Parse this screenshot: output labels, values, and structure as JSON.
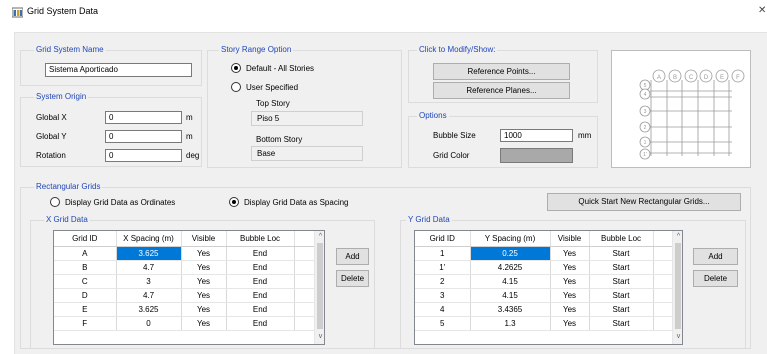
{
  "window": {
    "title": "Grid System Data",
    "close_glyph": "✕"
  },
  "grid_system_name": {
    "label": "Grid System Name",
    "value": "Sistema Aporticado"
  },
  "system_origin": {
    "label": "System Origin",
    "global_x": {
      "label": "Global  X",
      "value": "0",
      "unit": "m"
    },
    "global_y": {
      "label": "Global  Y",
      "value": "0",
      "unit": "m"
    },
    "rotation": {
      "label": "Rotation",
      "value": "0",
      "unit": "deg"
    }
  },
  "story_range": {
    "label": "Story Range Option",
    "default_label": "Default - All Stories",
    "user_label": "User Specified",
    "top_story_label": "Top Story",
    "top_story_value": "Piso 5",
    "bottom_story_label": "Bottom Story",
    "bottom_story_value": "Base",
    "selected": "default"
  },
  "modify_show": {
    "label": "Click to Modify/Show:",
    "reference_points": "Reference Points...",
    "reference_planes": "Reference Planes..."
  },
  "options": {
    "label": "Options",
    "bubble_size_label": "Bubble Size",
    "bubble_size_value": "1000",
    "bubble_size_unit": "mm",
    "grid_color_label": "Grid Color",
    "grid_color": "#a9a9a9"
  },
  "preview": {
    "x_bubbles": [
      "A",
      "B",
      "C",
      "D",
      "E",
      "F"
    ],
    "y_bubbles": [
      "5",
      "4",
      "3",
      "2",
      "1",
      "1'"
    ]
  },
  "rectangular_grids": {
    "label": "Rectangular Grids",
    "ordinates_label": "Display Grid Data as Ordinates",
    "spacing_label": "Display Grid Data as Spacing",
    "selected": "spacing",
    "quick_start": "Quick Start New Rectangular Grids..."
  },
  "x_grid": {
    "label": "X Grid Data",
    "headers": [
      "Grid ID",
      "X Spacing  (m)",
      "Visible",
      "Bubble Loc"
    ],
    "rows": [
      [
        "A",
        "3.625",
        "Yes",
        "End"
      ],
      [
        "B",
        "4.7",
        "Yes",
        "End"
      ],
      [
        "C",
        "3",
        "Yes",
        "End"
      ],
      [
        "D",
        "4.7",
        "Yes",
        "End"
      ],
      [
        "E",
        "3.625",
        "Yes",
        "End"
      ],
      [
        "F",
        "0",
        "Yes",
        "End"
      ]
    ],
    "add": "Add",
    "delete": "Delete"
  },
  "y_grid": {
    "label": "Y Grid Data",
    "headers": [
      "Grid ID",
      "Y Spacing  (m)",
      "Visible",
      "Bubble Loc"
    ],
    "rows": [
      [
        "1",
        "0.25",
        "Yes",
        "Start"
      ],
      [
        "1'",
        "4.2625",
        "Yes",
        "Start"
      ],
      [
        "2",
        "4.15",
        "Yes",
        "Start"
      ],
      [
        "3",
        "4.15",
        "Yes",
        "Start"
      ],
      [
        "4",
        "3.4365",
        "Yes",
        "Start"
      ],
      [
        "5",
        "1.3",
        "Yes",
        "Start"
      ]
    ],
    "add": "Add",
    "delete": "Delete"
  },
  "scroll_icons": {
    "up": "^",
    "down": "v"
  },
  "colors": {
    "group_label": "#1f46b8",
    "selection": "#0078d7"
  }
}
